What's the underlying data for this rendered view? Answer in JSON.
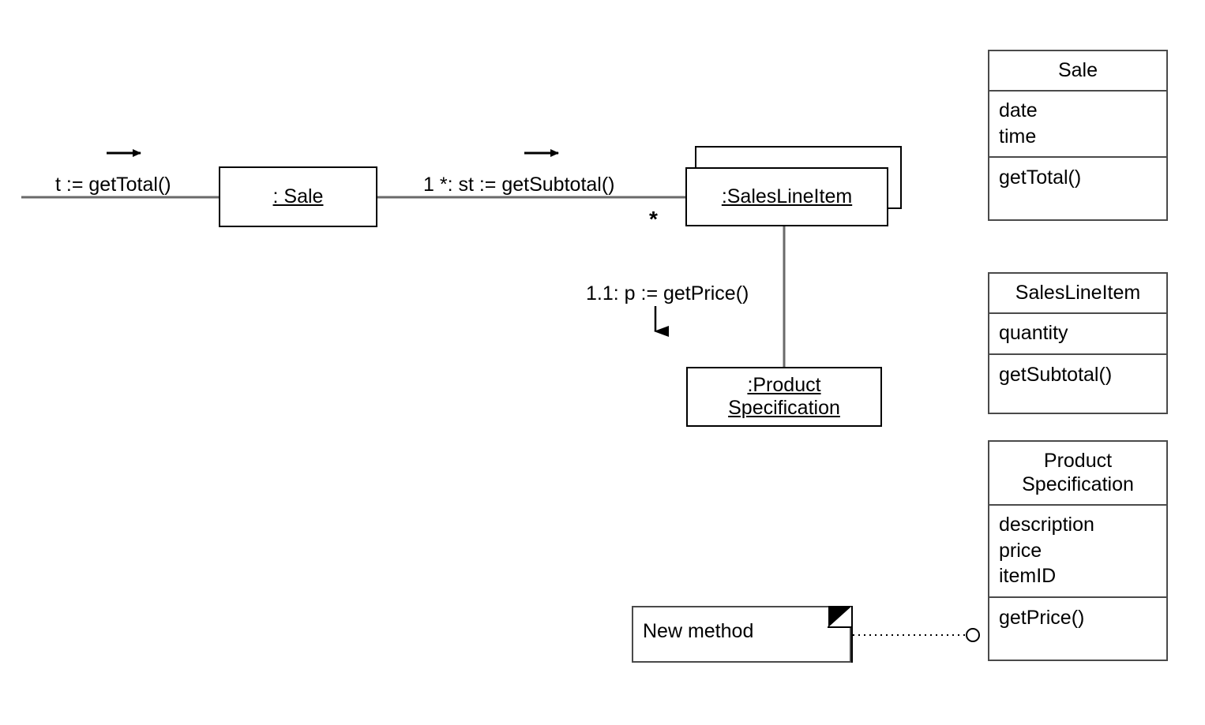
{
  "diagram": {
    "type": "uml-collaboration-and-class-diagram",
    "objects": [
      {
        "id": "sale",
        "label": ": Sale",
        "multi": false
      },
      {
        "id": "salesLineItem",
        "label": ":SalesLineItem",
        "multi": true
      },
      {
        "id": "productSpecification",
        "label": ":Product\nSpecification",
        "multi": false
      }
    ],
    "messages": [
      {
        "id": "m1",
        "text": "t := getTotal()"
      },
      {
        "id": "m2",
        "text": "1 *: st := getSubtotal()"
      },
      {
        "id": "m3",
        "text": "1.1: p := getPrice()"
      }
    ],
    "multiplicity": {
      "salesLineItem": "*"
    },
    "note": {
      "text": "New method"
    }
  },
  "classes": [
    {
      "id": "sale",
      "name": "Sale",
      "attributes": "date\ntime",
      "operations": "getTotal()"
    },
    {
      "id": "salesLineItem",
      "name": "SalesLineItem",
      "attributes": "quantity",
      "operations": "getSubtotal()"
    },
    {
      "id": "productSpecification",
      "name": "Product\nSpecification",
      "attributes": "description\nprice\nitemID",
      "operations": "getPrice()"
    }
  ],
  "colors": {
    "background": "#ffffff",
    "stroke": "#000000",
    "box_stroke": "#4a4a4a",
    "link_stroke": "#6a6a6a"
  }
}
